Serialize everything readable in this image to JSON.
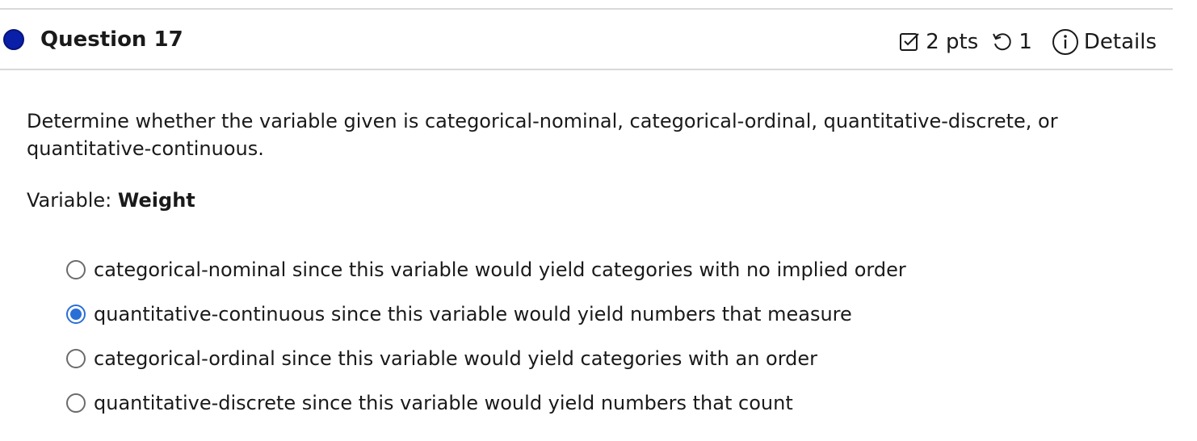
{
  "question": {
    "title": "Question 17",
    "points": "2 pts",
    "retries": "1",
    "details_label": "Details"
  },
  "prompt": "Determine whether the variable given is categorical-nominal, categorical-ordinal, quantitative-discrete, or quantitative-continuous.",
  "variable": {
    "label": "Variable: ",
    "value": "Weight"
  },
  "options": [
    {
      "label": "categorical-nominal since this variable would yield categories with no implied order",
      "selected": false
    },
    {
      "label": "quantitative-continuous since this variable would yield numbers that measure",
      "selected": true
    },
    {
      "label": "categorical-ordinal since this variable would yield categories with an order",
      "selected": false
    },
    {
      "label": "quantitative-discrete since this variable would yield numbers that count",
      "selected": false
    }
  ],
  "colors": {
    "status_dot": "#0a1fa8",
    "radio_selected": "#2a6fd6"
  }
}
